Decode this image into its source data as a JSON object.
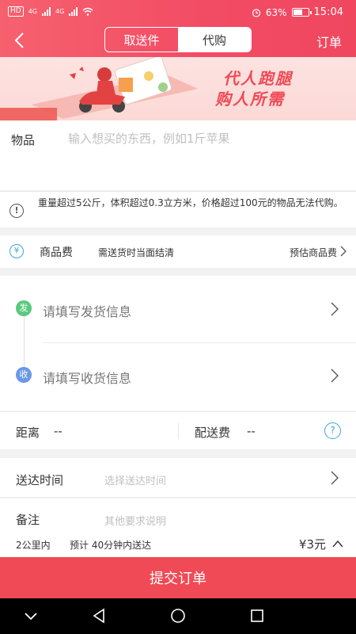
{
  "status_bar": {
    "network_badge": "HD",
    "signal_1": "4G",
    "signal_2": "4G",
    "battery": "63%",
    "battery_level": 0.63,
    "time": "15:04"
  },
  "header": {
    "tabs": [
      {
        "label": "取送件",
        "active": false
      },
      {
        "label": "代购",
        "active": true
      }
    ],
    "orders_label": "订单"
  },
  "banner": {
    "line1": "代人跑腿",
    "line2": "购人所需"
  },
  "item": {
    "label": "物品",
    "placeholder": "输入想买的东西，例如1斤苹果"
  },
  "notice": {
    "icon": "!",
    "text": "重量超过5公斤，体积超过0.3立方米，价格超过100元的物品无法代购。"
  },
  "goods_fee": {
    "icon": "¥",
    "label": "商品费",
    "desc": "需送货时当面结清",
    "estimate_label": "预估商品费"
  },
  "address": {
    "send_badge": "发",
    "send_text": "请填写发货信息",
    "recv_badge": "收",
    "recv_text": "请填写收货信息"
  },
  "distance": {
    "label": "距离",
    "value": "--",
    "ship_label": "配送费",
    "ship_value": "--",
    "help": "?"
  },
  "delivery_time": {
    "label": "送达时间",
    "placeholder": "选择送达时间"
  },
  "remark": {
    "label": "备注",
    "placeholder": "其他要求说明"
  },
  "summary": {
    "distance": "2公里内",
    "estimate": "预计 40分钟内送达",
    "price": "¥3元"
  },
  "submit_label": "提交订单",
  "colors": {
    "accent": "#ef4a55",
    "send_green": "#59c97e",
    "recv_blue": "#6b98e6",
    "info_blue": "#3aa6d6"
  }
}
